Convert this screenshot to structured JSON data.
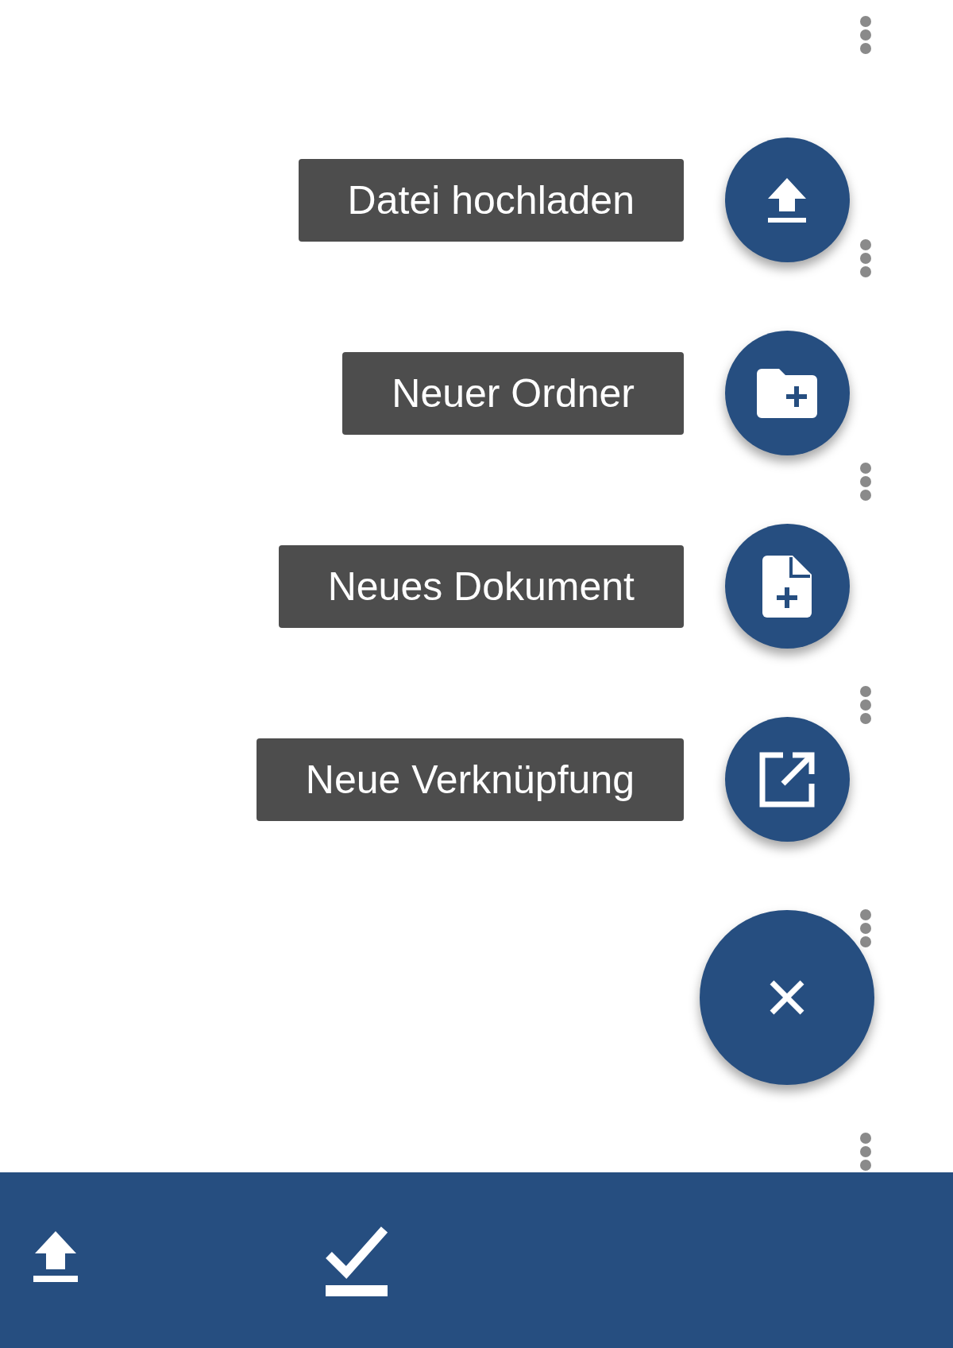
{
  "speed_dial": {
    "actions": [
      {
        "label": "Datei hochladen",
        "kind": "upload"
      },
      {
        "label": "Neuer Ordner",
        "kind": "folder"
      },
      {
        "label": "Neues Dokument",
        "kind": "document"
      },
      {
        "label": "Neue Verknüpfung",
        "kind": "link"
      }
    ],
    "close_button": {
      "kind": "close"
    }
  },
  "bottom_bar": {
    "actions": [
      {
        "kind": "upload"
      },
      {
        "kind": "check"
      }
    ]
  }
}
